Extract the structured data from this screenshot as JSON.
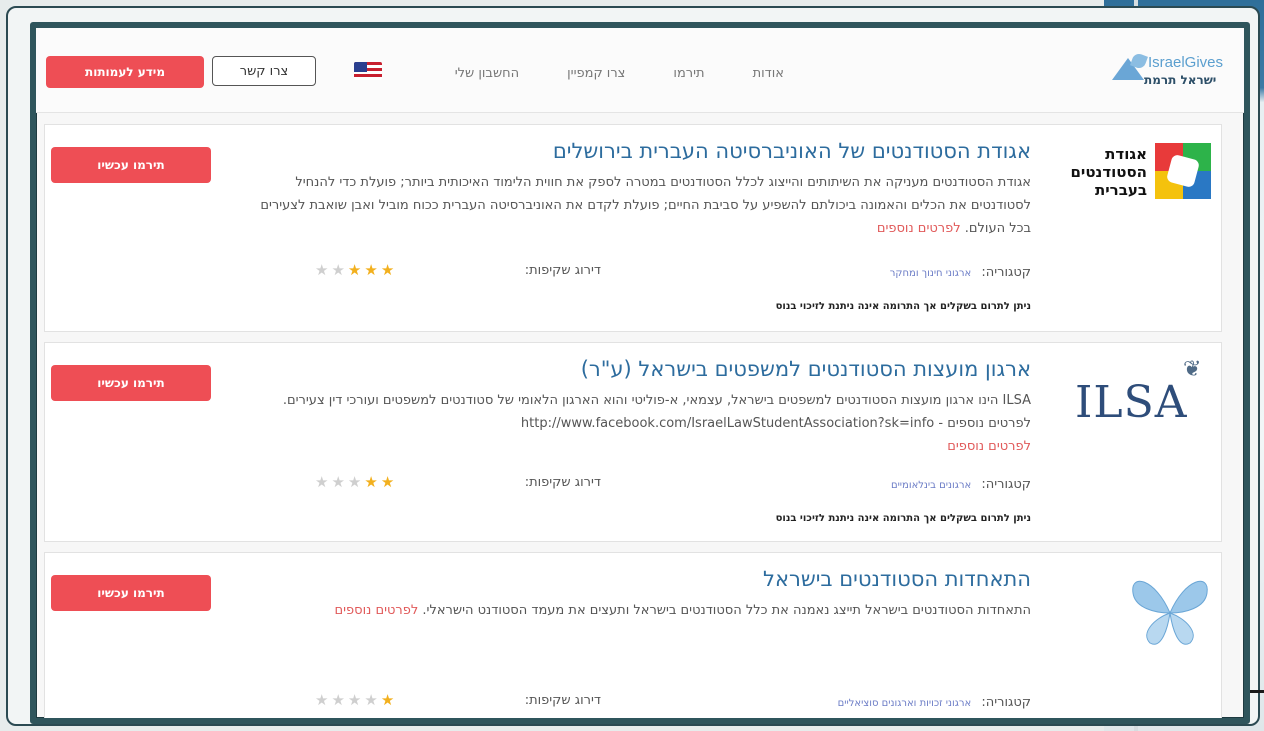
{
  "header": {
    "logo_en": "IsraelGives",
    "logo_he": "ישראל תרמת",
    "nav": [
      "אודות",
      "תירמו",
      "צרו קמפיין",
      "החשבון שלי"
    ],
    "contact_label": "צרו קשר",
    "volunteer_label": "מידע לעמותות"
  },
  "orgs": [
    {
      "logo_text": "אגודת הסטודנטים בעברית",
      "title": "אגודת הסטודנטים של האוניברסיטה העברית בירושלים",
      "description": "אגודת הסטודנטים מעניקה את השיתותים והייצוג לכלל הסטודנטים במטרה לספק את חווית הלימוד האיכותית ביותר; פועלת כדי להנחיל לסטודנטים את הכלים והאמונה ביכולתם להשפיע על סביבת החיים; פועלת לקדם את האוניברסיטה העברית ככוח מוביל ואבן שואבת לצעירים בכל העולם.",
      "more": "לפרטים נוספים",
      "category_label": "קטגוריה:",
      "category_value": "ארגוני חינוך ומחקר",
      "rating_label": "דירוג שקיפות:",
      "stars": 3,
      "note": "ניתן לתרום בשקלים אך התרומה אינה ניתנת לזיכוי בנוס",
      "donate": "תירמו עכשיו"
    },
    {
      "logo_text": "ILSA",
      "title": "ארגון מועצות הסטודנטים למשפטים בישראל (ע\"ר)",
      "description": "ILSA הינו ארגון מועצות הסטודנטים למשפטים בישראל, עצמאי, א-פוליטי והוא הארגון הלאומי של סטודנטים למשפטים ועורכי דין צעירים. לפרטים נוספים - http://www.facebook.com/IsraelLawStudentAssociation?sk=info",
      "more": "לפרטים נוספים",
      "category_label": "קטגוריה:",
      "category_value": "ארגונים בינלאומיים",
      "rating_label": "דירוג שקיפות:",
      "stars": 2,
      "note": "ניתן לתרום בשקלים אך התרומה אינה ניתנת לזיכוי בנוס",
      "donate": "תירמו עכשיו"
    },
    {
      "logo_text": "",
      "title": "התאחדות הסטודנטים בישראל",
      "description": "התאחדות הסטודנטים בישראל תייצג נאמנה את כלל הסטודנטים בישראל ותעצים את מעמד הסטודנט הישראלי.",
      "more": "לפרטים נוספים",
      "category_label": "קטגוריה:",
      "category_value": "ארגוני זכויות וארגונים סוציאליים",
      "rating_label": "דירוג שקיפות:",
      "stars": 1,
      "note": "",
      "donate": "תירמו עכשיו"
    }
  ],
  "colors": {
    "accent_red": "#ee4e55",
    "title_blue": "#2d6c9e",
    "star_gold": "#f2b01e",
    "frame": "#2f555c"
  }
}
